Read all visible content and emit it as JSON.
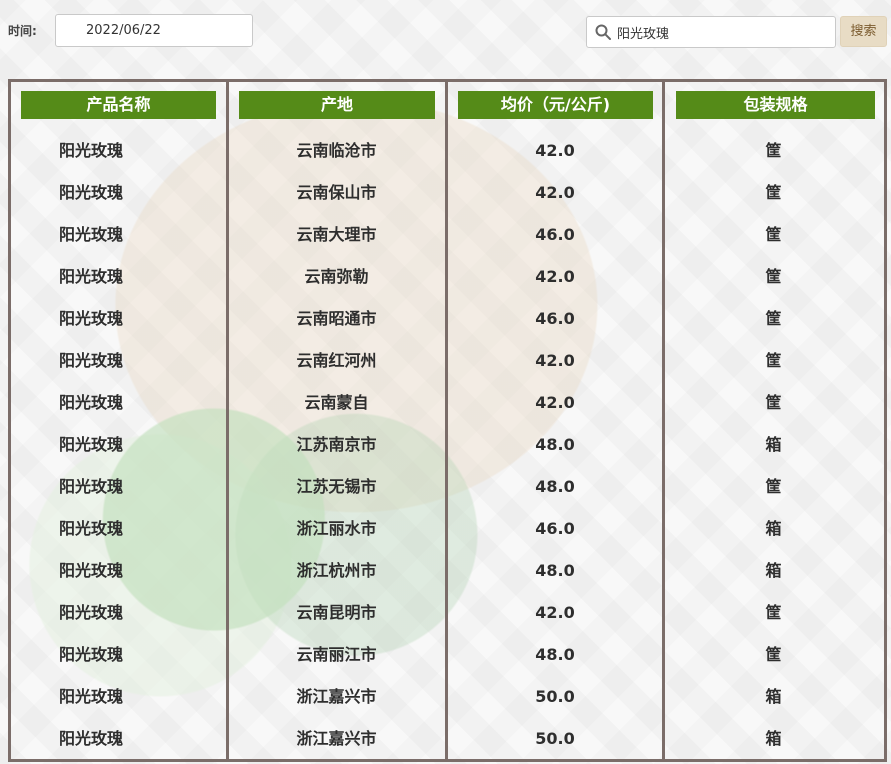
{
  "filter": {
    "time_label": "时间:",
    "date_value": "2022/06/22"
  },
  "search": {
    "value": "阳光玫瑰",
    "button_label": "搜索"
  },
  "table": {
    "headers": [
      "产品名称",
      "产地",
      "均价（元/公斤)",
      "包装规格"
    ],
    "rows": [
      [
        "阳光玫瑰",
        "云南临沧市",
        "42.0",
        "筐"
      ],
      [
        "阳光玫瑰",
        "云南保山市",
        "42.0",
        "筐"
      ],
      [
        "阳光玫瑰",
        "云南大理市",
        "46.0",
        "筐"
      ],
      [
        "阳光玫瑰",
        "云南弥勒",
        "42.0",
        "筐"
      ],
      [
        "阳光玫瑰",
        "云南昭通市",
        "46.0",
        "筐"
      ],
      [
        "阳光玫瑰",
        "云南红河州",
        "42.0",
        "筐"
      ],
      [
        "阳光玫瑰",
        "云南蒙自",
        "42.0",
        "筐"
      ],
      [
        "阳光玫瑰",
        "江苏南京市",
        "48.0",
        "箱"
      ],
      [
        "阳光玫瑰",
        "江苏无锡市",
        "48.0",
        "筐"
      ],
      [
        "阳光玫瑰",
        "浙江丽水市",
        "46.0",
        "箱"
      ],
      [
        "阳光玫瑰",
        "浙江杭州市",
        "48.0",
        "箱"
      ],
      [
        "阳光玫瑰",
        "云南昆明市",
        "42.0",
        "筐"
      ],
      [
        "阳光玫瑰",
        "云南丽江市",
        "48.0",
        "筐"
      ],
      [
        "阳光玫瑰",
        "浙江嘉兴市",
        "50.0",
        "箱"
      ],
      [
        "阳光玫瑰",
        "浙江嘉兴市",
        "50.0",
        "箱"
      ]
    ]
  },
  "colors": {
    "header_bg": "#558b18",
    "border": "#7b6d69",
    "search_button_bg": "#e8dcc5"
  },
  "icons": {
    "search": "search-icon"
  }
}
